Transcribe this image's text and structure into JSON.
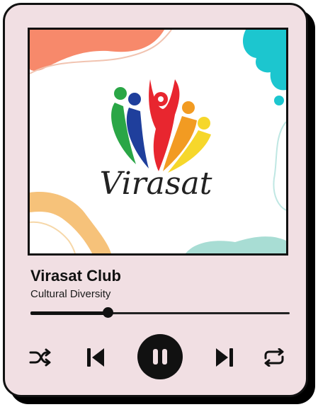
{
  "track": {
    "title": "Virasat Club",
    "subtitle": "Cultural Diversity",
    "progress_fraction": 0.3
  },
  "artwork": {
    "logo_text": "Virasat",
    "colors": {
      "coral": "#f7896b",
      "teal": "#1cc6cf",
      "mint": "#a8ddd4",
      "apricot": "#f6c27a",
      "red": "#e8262f",
      "blue": "#1f3f9c",
      "green": "#2aa646",
      "orange": "#f29b22",
      "yellow": "#f6d72b"
    }
  },
  "controls": {
    "shuffle": "shuffle-icon",
    "previous": "skip-previous-icon",
    "pause": "pause-icon",
    "next": "skip-next-icon",
    "repeat": "repeat-icon"
  },
  "theme": {
    "card_bg": "#f1dfe3",
    "ink": "#111111"
  }
}
